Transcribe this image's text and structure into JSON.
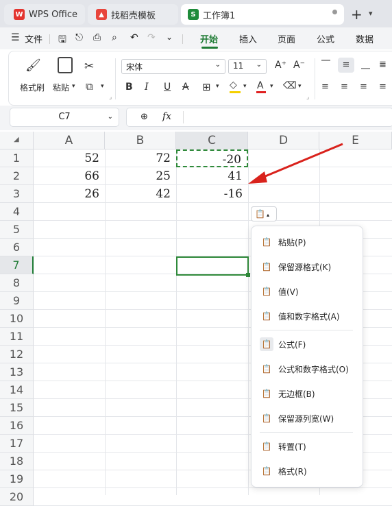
{
  "tabs": [
    {
      "label": "WPS Office",
      "icon": "wps-logo-icon"
    },
    {
      "label": "找稻壳模板",
      "icon": "docer-icon"
    },
    {
      "label": "工作簿1",
      "icon": "sheet-icon"
    }
  ],
  "menu": {
    "file": "文件",
    "items": [
      "开始",
      "插入",
      "页面",
      "公式",
      "数据"
    ],
    "active": "开始"
  },
  "ribbon": {
    "format_painter": "格式刷",
    "paste": "粘贴",
    "font_name": "宋体",
    "font_size": "11"
  },
  "formula_bar": {
    "cell_ref": "C7",
    "fx": "fx"
  },
  "columns": [
    "A",
    "B",
    "C",
    "D",
    "E"
  ],
  "rows": [
    "1",
    "2",
    "3",
    "4",
    "5",
    "6",
    "7",
    "8",
    "9",
    "10",
    "11",
    "12",
    "13",
    "14",
    "15",
    "16",
    "17",
    "18",
    "19",
    "20"
  ],
  "cells": {
    "a1": "52",
    "b1": "72",
    "c1": "-20",
    "a2": "66",
    "b2": "25",
    "c2": "41",
    "a3": "26",
    "b3": "42",
    "c3": "-16"
  },
  "paste_menu": [
    {
      "label": "粘贴(P)",
      "icon": "paste-icon"
    },
    {
      "label": "保留源格式(K)",
      "icon": "keep-source-format-icon"
    },
    {
      "label": "值(V)",
      "icon": "paste-values-icon"
    },
    {
      "label": "值和数字格式(A)",
      "icon": "values-number-format-icon"
    },
    {
      "label": "公式(F)",
      "icon": "paste-formula-icon"
    },
    {
      "label": "公式和数字格式(O)",
      "icon": "formula-number-format-icon"
    },
    {
      "label": "无边框(B)",
      "icon": "no-borders-icon"
    },
    {
      "label": "保留源列宽(W)",
      "icon": "keep-column-width-icon"
    },
    {
      "label": "转置(T)",
      "icon": "transpose-icon"
    },
    {
      "label": "格式(R)",
      "icon": "paste-format-icon"
    }
  ],
  "colors": {
    "accent": "#1e7b34",
    "arrow": "#d9221c",
    "selection": "#2f8a3a"
  }
}
